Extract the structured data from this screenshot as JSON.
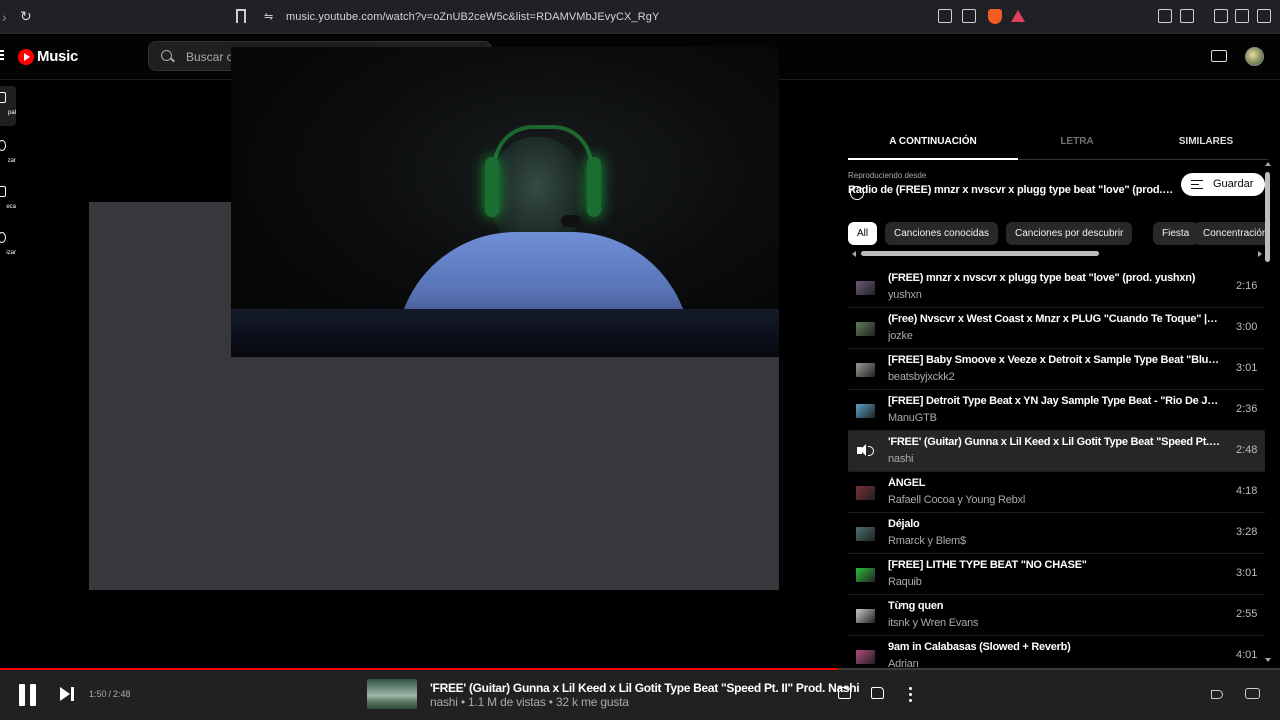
{
  "browser": {
    "url": "music.youtube.com/watch?v=oZnUB2ceW5c&list=RDAMVMbJEvyCX_RgY"
  },
  "header": {
    "logo_text": "Music",
    "search_placeholder": "Buscar c"
  },
  "guide": {
    "items": [
      {
        "label": "pal",
        "icon": "home-icon"
      },
      {
        "label": "zar",
        "icon": "explore-icon"
      },
      {
        "label": "eca",
        "icon": "library-icon"
      },
      {
        "label": "izar",
        "icon": "upgrade-icon"
      }
    ]
  },
  "queue_panel": {
    "tabs": [
      "A CONTINUACIÓN",
      "LETRA",
      "SIMILARES"
    ],
    "playing_from_label": "Reproduciendo desde",
    "radio_title": "Radio de (FREE) mnzr x nvscvr x plugg type beat \"love\" (prod. yushxn)",
    "save_label": "Guardar",
    "chips": [
      "All",
      "Canciones conocidas",
      "Canciones por descubrir",
      "Fiesta",
      "Concentración"
    ],
    "items": [
      {
        "title": "(FREE) mnzr x nvscvr x plugg type beat \"love\" (prod. yushxn)",
        "artist": "yushxn",
        "duration": "2:16",
        "thumb_color": "#6b5a7a"
      },
      {
        "title": "(Free) Nvscvr x West Coast x Mnzr x PLUG \"Cuando Te Toque\" | (Prod. jozke)",
        "artist": "jozke",
        "duration": "3:00",
        "thumb_color": "#5f7f5a"
      },
      {
        "title": "[FREE] Baby Smoove x Veeze x Detroit x Sample Type Beat \"Blue Dream\"",
        "artist": "beatsbyjxckk2",
        "duration": "3:01",
        "thumb_color": "#9a9a92"
      },
      {
        "title": "[FREE] Detroit Type Beat x YN Jay Sample Type Beat - \"Rio De Janeiro\"",
        "artist": "ManuGTB",
        "duration": "2:36",
        "thumb_color": "#5aa0c8"
      },
      {
        "title": "'FREE' (Guitar) Gunna x Lil Keed x Lil Gotit Type Beat \"Speed Pt. II\" Prod. Nashi",
        "artist": "nashi",
        "duration": "2:48",
        "current": true
      },
      {
        "title": "ÁNGEL",
        "artist": "Rafaell Cocoa y Young Rebxl",
        "duration": "4:18",
        "thumb_color": "#7a2e32"
      },
      {
        "title": "Déjalo",
        "artist": "Rmarck y Blem$",
        "duration": "3:28",
        "thumb_color": "#4a7070"
      },
      {
        "title": "[FREE] LITHE TYPE BEAT \"NO CHASE\"",
        "artist": "Raquib",
        "duration": "3:01",
        "thumb_color": "#2bbf3a"
      },
      {
        "title": "Từng quen",
        "artist": "itsnk y Wren Evans",
        "duration": "2:55",
        "thumb_color": "#c8c8c8"
      },
      {
        "title": "9am in Calabasas (Slowed + Reverb)",
        "artist": "Adrian",
        "duration": "4:01",
        "thumb_color": "#b04a7a"
      }
    ]
  },
  "player_bar": {
    "current_time": "1:50",
    "total_time": "2:48",
    "progress_fraction": 0.655,
    "title": "'FREE' (Guitar) Gunna x Lil Keed x Lil Gotit Type Beat \"Speed Pt. II\" Prod. Nashi",
    "subtitle": "nashi • 1.1 M de vistas • 32 k me gusta",
    "accent_color": "#ff0000"
  }
}
